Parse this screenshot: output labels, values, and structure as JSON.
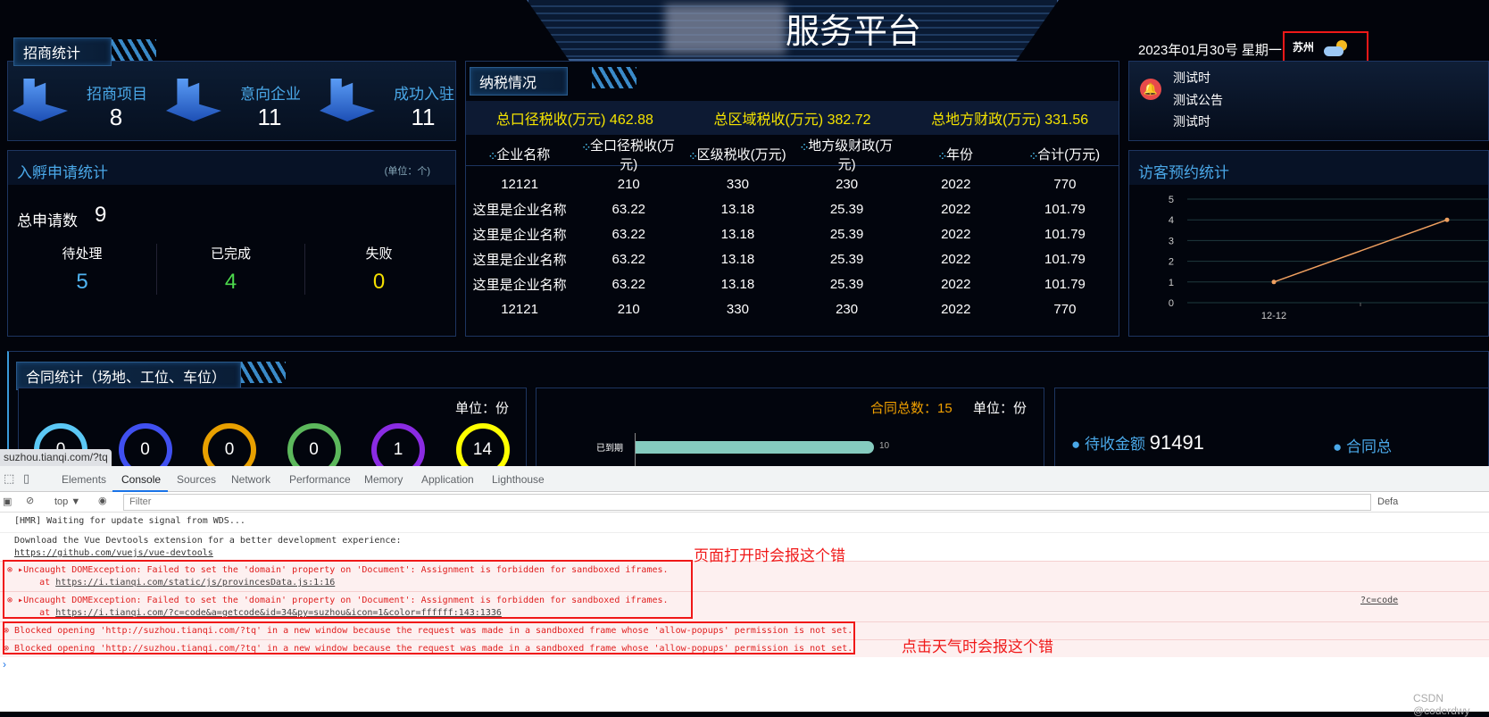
{
  "header": {
    "title_visible": "服务平台",
    "date": "2023年01月30号 星期一",
    "weather_city": "苏州",
    "weather_icon": "partly-cloudy-icon"
  },
  "investment": {
    "title": "招商统计",
    "items": [
      {
        "label": "招商项目",
        "value": "8"
      },
      {
        "label": "意向企业",
        "value": "11"
      },
      {
        "label": "成功入驻",
        "value": "11"
      }
    ]
  },
  "incubation": {
    "title": "入孵申请统计",
    "unit": "(单位：个)",
    "total_label": "总申请数",
    "total": "9",
    "items": [
      {
        "label": "待处理",
        "value": "5",
        "color": "#4fb3f0"
      },
      {
        "label": "已完成",
        "value": "4",
        "color": "#4cd94c"
      },
      {
        "label": "失败",
        "value": "0",
        "color": "#f5e000"
      }
    ]
  },
  "tax": {
    "title": "纳税情况",
    "summary": [
      {
        "label": "总口径税收(万元)",
        "value": "462.88"
      },
      {
        "label": "总区域税收(万元)",
        "value": "382.72"
      },
      {
        "label": "总地方财政(万元)",
        "value": "331.56"
      }
    ],
    "columns": [
      "企业名称",
      "全口径税收(万元)",
      "区级税收(万元)",
      "地方级财政(万元)",
      "年份",
      "合计(万元)"
    ],
    "rows": [
      [
        "12121",
        "210",
        "330",
        "230",
        "2022",
        "770"
      ],
      [
        "这里是企业名称",
        "63.22",
        "13.18",
        "25.39",
        "2022",
        "101.79"
      ],
      [
        "这里是企业名称",
        "63.22",
        "13.18",
        "25.39",
        "2022",
        "101.79"
      ],
      [
        "这里是企业名称",
        "63.22",
        "13.18",
        "25.39",
        "2022",
        "101.79"
      ],
      [
        "这里是企业名称",
        "63.22",
        "13.18",
        "25.39",
        "2022",
        "101.79"
      ],
      [
        "12121",
        "210",
        "330",
        "230",
        "2022",
        "770"
      ]
    ]
  },
  "notice": {
    "items": [
      "测试时",
      "测试公告",
      "测试时"
    ]
  },
  "visitors": {
    "title": "访客预约统计"
  },
  "chart_data": {
    "type": "line",
    "categories": [
      "12-12",
      ""
    ],
    "values": [
      1,
      4
    ],
    "ylim": [
      0,
      5
    ],
    "yticks": [
      0,
      1,
      2,
      3,
      4,
      5
    ],
    "grid": true,
    "color": "#f0a060"
  },
  "contracts": {
    "title": "合同统计（场地、工位、车位）",
    "unit": "单位：份",
    "rings": [
      {
        "value": "0",
        "color": "#5bc8f5"
      },
      {
        "value": "0",
        "color": "#4050f0"
      },
      {
        "value": "0",
        "color": "#e8a000"
      },
      {
        "value": "0",
        "color": "#5cb85c"
      },
      {
        "value": "1",
        "color": "#8a2be2"
      },
      {
        "value": "14",
        "color": "#ffff00"
      }
    ],
    "total": "合同总数：15",
    "bar_label": "已到期",
    "bar_value": "10",
    "receivable_label": "待收金额",
    "receivable": "91491",
    "contract_total_label": "合同总"
  },
  "tooltip": "suzhou.tianqi.com/?tq",
  "devtools": {
    "tabs": [
      "Elements",
      "Console",
      "Sources",
      "Network",
      "Performance",
      "Memory",
      "Application",
      "Lighthouse"
    ],
    "context": "top ▼",
    "filter_placeholder": "Filter",
    "levels": "Defa",
    "messages": {
      "hmr": "[HMR] Waiting for update signal from WDS...",
      "vue1": "Download the Vue Devtools extension for a better development experience:",
      "vue2": "https://github.com/vuejs/vue-devtools",
      "err1": "Uncaught DOMException: Failed to set the 'domain' property on 'Document': Assignment is forbidden for sandboxed iframes.",
      "err1at": "https://i.tianqi.com/static/js/provincesData.js:1:16",
      "err2": "Uncaught DOMException: Failed to set the 'domain' property on 'Document': Assignment is forbidden for sandboxed iframes.",
      "err2at": "https://i.tianqi.com/?c=code&a=getcode&id=34&py=suzhou&icon=1&color=ffffff:143:1336",
      "err2src": "?c=code",
      "block1": "Blocked opening 'http://suzhou.tianqi.com/?tq' in a new window because the request was made in a sandboxed frame whose 'allow-popups' permission is not set.",
      "block2": "Blocked opening 'http://suzhou.tianqi.com/?tq' in a new window because the request was made in a sandboxed frame whose 'allow-popups' permission is not set."
    }
  },
  "annotations": {
    "open": "页面打开时会报这个错",
    "click": "点击天气时会报这个错"
  },
  "watermark": "CSDN @coderdwy"
}
